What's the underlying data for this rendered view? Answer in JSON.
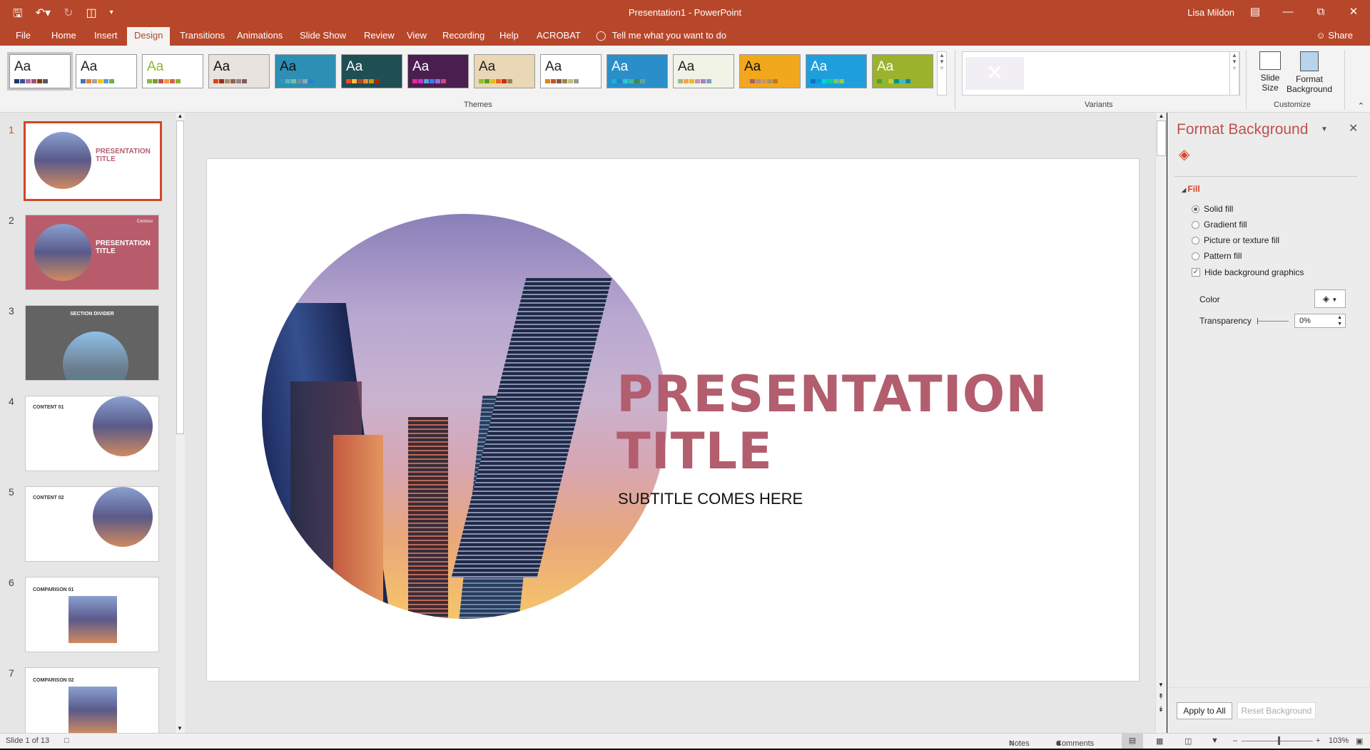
{
  "window": {
    "title": "Presentation1  -  PowerPoint",
    "user": "Lisa Mildon"
  },
  "tabs": [
    "File",
    "Home",
    "Insert",
    "Design",
    "Transitions",
    "Animations",
    "Slide Show",
    "Review",
    "View",
    "Recording",
    "Help",
    "ACROBAT"
  ],
  "active_tab": "Design",
  "tell_me": "Tell me what you want to do",
  "share": "Share",
  "themes": {
    "label": "Themes",
    "items": [
      {
        "aa": "Aa",
        "bg": "#ffffff",
        "fg": "#222222",
        "sw": [
          "#1f3864",
          "#2e5597",
          "#c0699a",
          "#9f5474",
          "#843c0c",
          "#595959"
        ]
      },
      {
        "aa": "Aa",
        "bg": "#ffffff",
        "fg": "#222222",
        "sw": [
          "#4472c4",
          "#ed7d31",
          "#a5a5a5",
          "#ffc000",
          "#5b9bd5",
          "#70ad47"
        ]
      },
      {
        "aa": "Aa",
        "bg": "#ffffff",
        "fg": "#8ab833",
        "sw": [
          "#8ab833",
          "#6ba32d",
          "#c0504d",
          "#f79646",
          "#d16349",
          "#8cb22c"
        ]
      },
      {
        "aa": "Aa",
        "bg": "#e9e3df",
        "fg": "#111111",
        "sw": [
          "#d34817",
          "#9b2d1f",
          "#a28e6a",
          "#956251",
          "#918485",
          "#855d5d"
        ]
      },
      {
        "aa": "Aa",
        "bg": "#2e8fb5",
        "fg": "#111111",
        "sw": [
          "#3494ba",
          "#58b6c0",
          "#75bda7",
          "#7a8c8e",
          "#84acb6",
          "#2683c6"
        ]
      },
      {
        "aa": "Aa",
        "bg": "#1f4e53",
        "fg": "#ffffff",
        "sw": [
          "#e84c22",
          "#ffbd47",
          "#b64926",
          "#ff8427",
          "#cc9900",
          "#b22600"
        ]
      },
      {
        "aa": "Aa",
        "bg": "#4a1f4f",
        "fg": "#ffffff",
        "sw": [
          "#e32d91",
          "#c830cc",
          "#4ea6dc",
          "#4775e7",
          "#8971e1",
          "#d54773"
        ]
      },
      {
        "aa": "Aa",
        "bg": "#ead7b5",
        "fg": "#222222",
        "sw": [
          "#90c226",
          "#54a021",
          "#e6b91e",
          "#e76618",
          "#c42f1a",
          "#918655"
        ]
      },
      {
        "aa": "Aa",
        "bg": "#ffffff",
        "fg": "#222222",
        "sw": [
          "#e48312",
          "#bd582c",
          "#865640",
          "#9b8357",
          "#c2bc80",
          "#94a088"
        ]
      },
      {
        "aa": "Aa",
        "bg": "#2a8fc9",
        "fg": "#ffffff",
        "sw": [
          "#1cade4",
          "#2683c6",
          "#27ced7",
          "#42ba97",
          "#3e8853",
          "#62a39f"
        ]
      },
      {
        "aa": "Aa",
        "bg": "#f0f3e6",
        "fg": "#222222",
        "sw": [
          "#a5b592",
          "#f3a447",
          "#e7bc29",
          "#d092a7",
          "#9c85c0",
          "#809ec2"
        ]
      },
      {
        "aa": "Aa",
        "bg": "#f2a81d",
        "fg": "#111111",
        "sw": [
          "#f0a22e",
          "#a5644e",
          "#b58b80",
          "#c3986d",
          "#a19574",
          "#c17529"
        ]
      },
      {
        "aa": "Aa",
        "bg": "#1e9fdc",
        "fg": "#ffffff",
        "sw": [
          "#0f6fc6",
          "#009dd9",
          "#0bd0d9",
          "#10cf9b",
          "#7cca62",
          "#a5c249"
        ]
      },
      {
        "aa": "Aa",
        "bg": "#9bb32c",
        "fg": "#ffffff",
        "sw": [
          "#549e39",
          "#8ab833",
          "#c0cf3a",
          "#029676",
          "#4ab5c4",
          "#0989b1"
        ]
      }
    ]
  },
  "variants": {
    "label": "Variants"
  },
  "customize": {
    "label": "Customize",
    "slide_size": "Slide Size",
    "format_background": "Format Background"
  },
  "slides": [
    {
      "num": "1",
      "title": "PRESENTATION TITLE",
      "bg": "#ffffff"
    },
    {
      "num": "2",
      "title": "PRESENTATION TITLE",
      "bg": "#b85c6c",
      "logo": "Contoso"
    },
    {
      "num": "3",
      "title": "SECTION DIVIDER",
      "bg": "#636363"
    },
    {
      "num": "4",
      "title": "CONTENT 01",
      "bg": "#ffffff"
    },
    {
      "num": "5",
      "title": "CONTENT 02",
      "bg": "#ffffff"
    },
    {
      "num": "6",
      "title": "COMPARISON 01",
      "bg": "#ffffff"
    },
    {
      "num": "7",
      "title": "COMPARISON 02",
      "bg": "#ffffff"
    }
  ],
  "main_slide": {
    "title_line1": "PRESENTATION",
    "title_line2": "TITLE",
    "subtitle": "SUBTITLE COMES HERE",
    "title_color": "#b25e6e"
  },
  "format_pane": {
    "title": "Format Background",
    "section": "Fill",
    "options": [
      {
        "label": "Solid fill",
        "checked": true
      },
      {
        "label": "Gradient fill",
        "checked": false
      },
      {
        "label": "Picture or texture fill",
        "checked": false
      },
      {
        "label": "Pattern fill",
        "checked": false
      }
    ],
    "hide_bg": "Hide background graphics",
    "color_label": "Color",
    "transparency_label": "Transparency",
    "transparency_value": "0%",
    "apply_all": "Apply to All",
    "reset": "Reset Background"
  },
  "status": {
    "slide_of": "Slide 1 of 13",
    "notes": "Notes",
    "comments": "Comments",
    "zoom": "103%",
    "zoom_percent": 103
  },
  "colors": {
    "accent": "#b7472a"
  }
}
